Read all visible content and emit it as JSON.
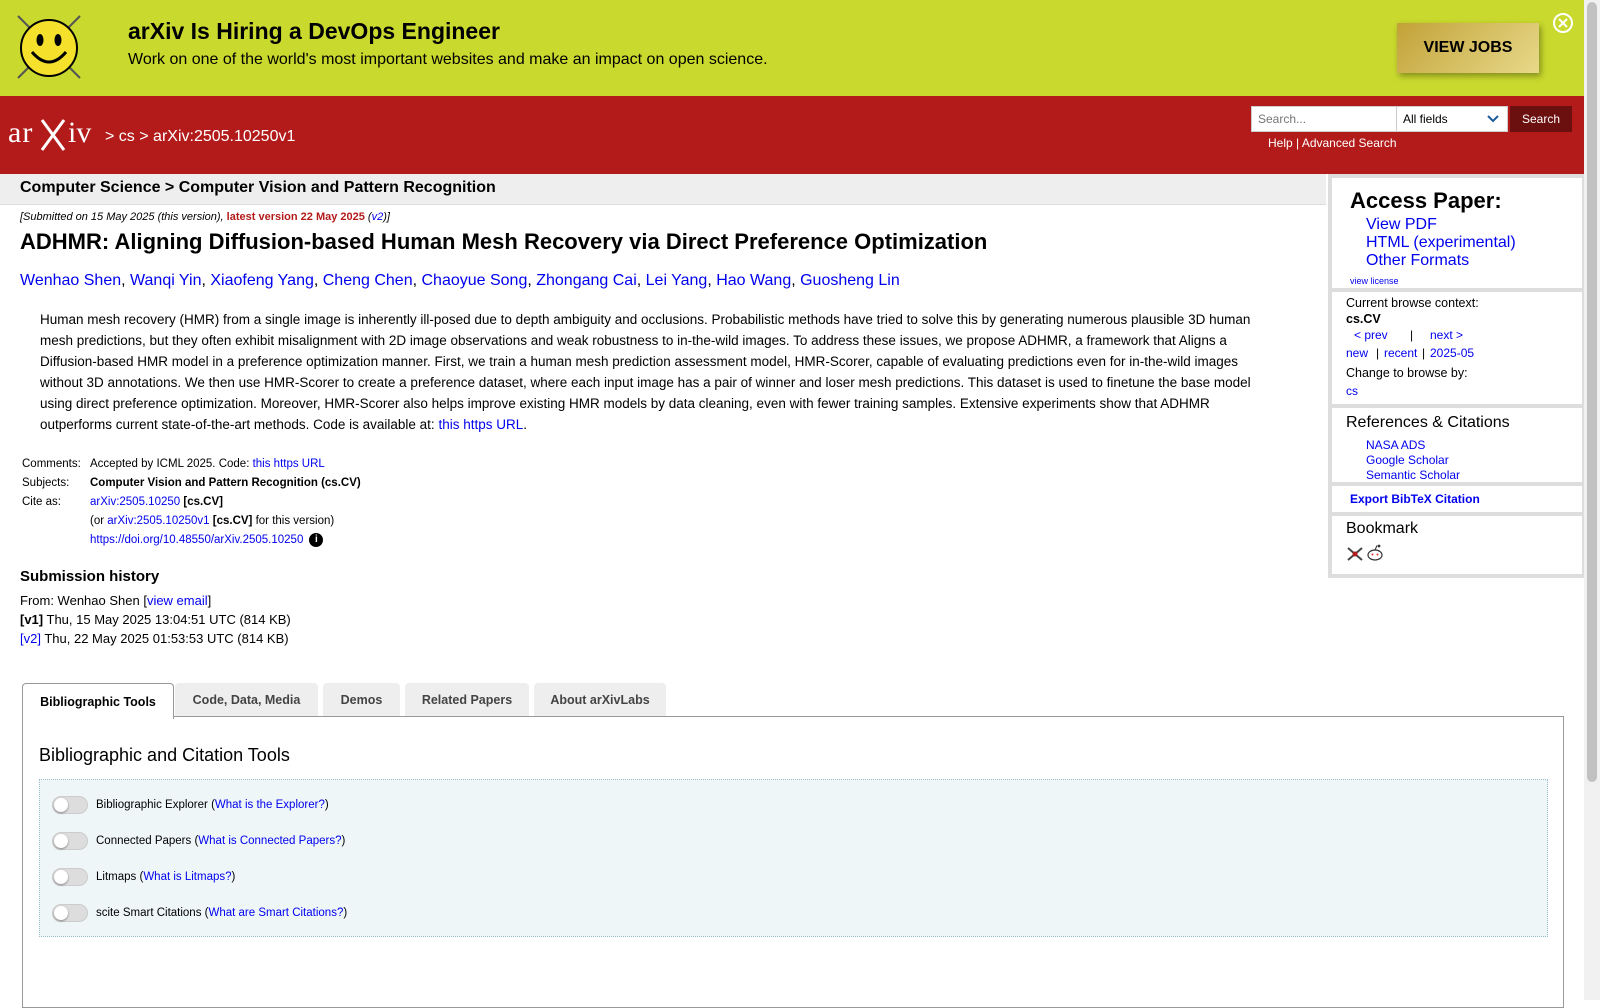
{
  "banner": {
    "title": "arXiv Is Hiring a DevOps Engineer",
    "subtitle": "Work on one of the world's most important websites and make an impact on open science.",
    "cta": "VIEW JOBS"
  },
  "header": {
    "crumb_sep1": ">",
    "crumb_cs": "cs",
    "crumb_sep2": ">",
    "crumb_id": "arXiv:2505.10250v1",
    "search_placeholder": "Search...",
    "search_field": "All fields",
    "search_button": "Search",
    "help": "Help",
    "help_sep": "|",
    "advanced": "Advanced Search"
  },
  "subject_bar": "Computer Science > Computer Vision and Pattern Recognition",
  "dateline": {
    "prefix": "[Submitted on 15 May 2025 (this version), ",
    "latest": "latest version 22 May 2025",
    "open": " (",
    "v2": "v2",
    "close": ")]"
  },
  "title": "ADHMR: Aligning Diffusion-based Human Mesh Recovery via Direct Preference Optimization",
  "authors": [
    "Wenhao Shen",
    "Wanqi Yin",
    "Xiaofeng Yang",
    "Cheng Chen",
    "Chaoyue Song",
    "Zhongang Cai",
    "Lei Yang",
    "Hao Wang",
    "Guosheng Lin"
  ],
  "abstract": {
    "text": "Human mesh recovery (HMR) from a single image is inherently ill-posed due to depth ambiguity and occlusions. Probabilistic methods have tried to solve this by generating numerous plausible 3D human mesh predictions, but they often exhibit misalignment with 2D image observations and weak robustness to in-the-wild images. To address these issues, we propose ADHMR, a framework that Aligns a Diffusion-based HMR model in a preference optimization manner. First, we train a human mesh prediction assessment model, HMR-Scorer, capable of evaluating predictions even for in-the-wild images without 3D annotations. We then use HMR-Scorer to create a preference dataset, where each input image has a pair of winner and loser mesh predictions. This dataset is used to finetune the base model using direct preference optimization. Moreover, HMR-Scorer also helps improve existing HMR models by data cleaning, even with fewer training samples. Extensive experiments show that ADHMR outperforms current state-of-the-art methods. Code is available at: ",
    "link": "this https URL",
    "end": "."
  },
  "meta": {
    "comments_label": "Comments:",
    "comments_text": "Accepted by ICML 2025. Code: ",
    "comments_link": "this https URL",
    "subjects_label": "Subjects:",
    "subjects_text": "Computer Vision and Pattern Recognition (cs.CV)",
    "cite_label": "Cite as:",
    "cite_id": "arXiv:2505.10250",
    "cite_cat": "[cs.CV]",
    "cite2_pre": "(or ",
    "cite2_id": "arXiv:2505.10250v1",
    "cite2_cat": "[cs.CV]",
    "cite2_post": " for this version)",
    "doi": "https://doi.org/10.48550/arXiv.2505.10250",
    "info": "i"
  },
  "history": {
    "heading": "Submission history",
    "from_pre": "From: Wenhao Shen [",
    "view_email": "view email",
    "from_post": "]",
    "v1_label": "[v1]",
    "v1_text": " Thu, 15 May 2025 13:04:51 UTC (814 KB)",
    "v2_label": "[v2]",
    "v2_text": " Thu, 22 May 2025 01:53:53 UTC (814 KB)"
  },
  "tabs": [
    "Bibliographic Tools",
    "Code, Data, Media",
    "Demos",
    "Related Papers",
    "About arXivLabs"
  ],
  "panel": {
    "title": "Bibliographic and Citation Tools",
    "tools": [
      {
        "name": "Bibliographic Explorer",
        "link": "What is the Explorer?"
      },
      {
        "name": "Connected Papers",
        "link": "What is Connected Papers?"
      },
      {
        "name": "Litmaps",
        "link": "What is Litmaps?"
      },
      {
        "name": "scite Smart Citations",
        "link": "What are Smart Citations?"
      }
    ]
  },
  "sidebar": {
    "access_heading": "Access Paper:",
    "view_pdf": "View PDF",
    "html": "HTML (experimental)",
    "other_formats": "Other Formats",
    "view_license": "view license",
    "context_label": "Current browse context:",
    "context_value": "cs.CV",
    "prev": "< prev",
    "sep": "|",
    "next": "next >",
    "new": "new",
    "recent": "recent",
    "month": "2025-05",
    "change_label": "Change to browse by:",
    "change_cs": "cs",
    "refs_heading": "References & Citations",
    "nasa": "NASA ADS",
    "google": "Google Scholar",
    "semantic": "Semantic Scholar",
    "bibtex": "Export BibTeX Citation",
    "bookmark_heading": "Bookmark"
  },
  "colors": {
    "header_red": "#b31b1b",
    "banner_green": "#c9d92e",
    "link_blue": "#0000ee"
  }
}
